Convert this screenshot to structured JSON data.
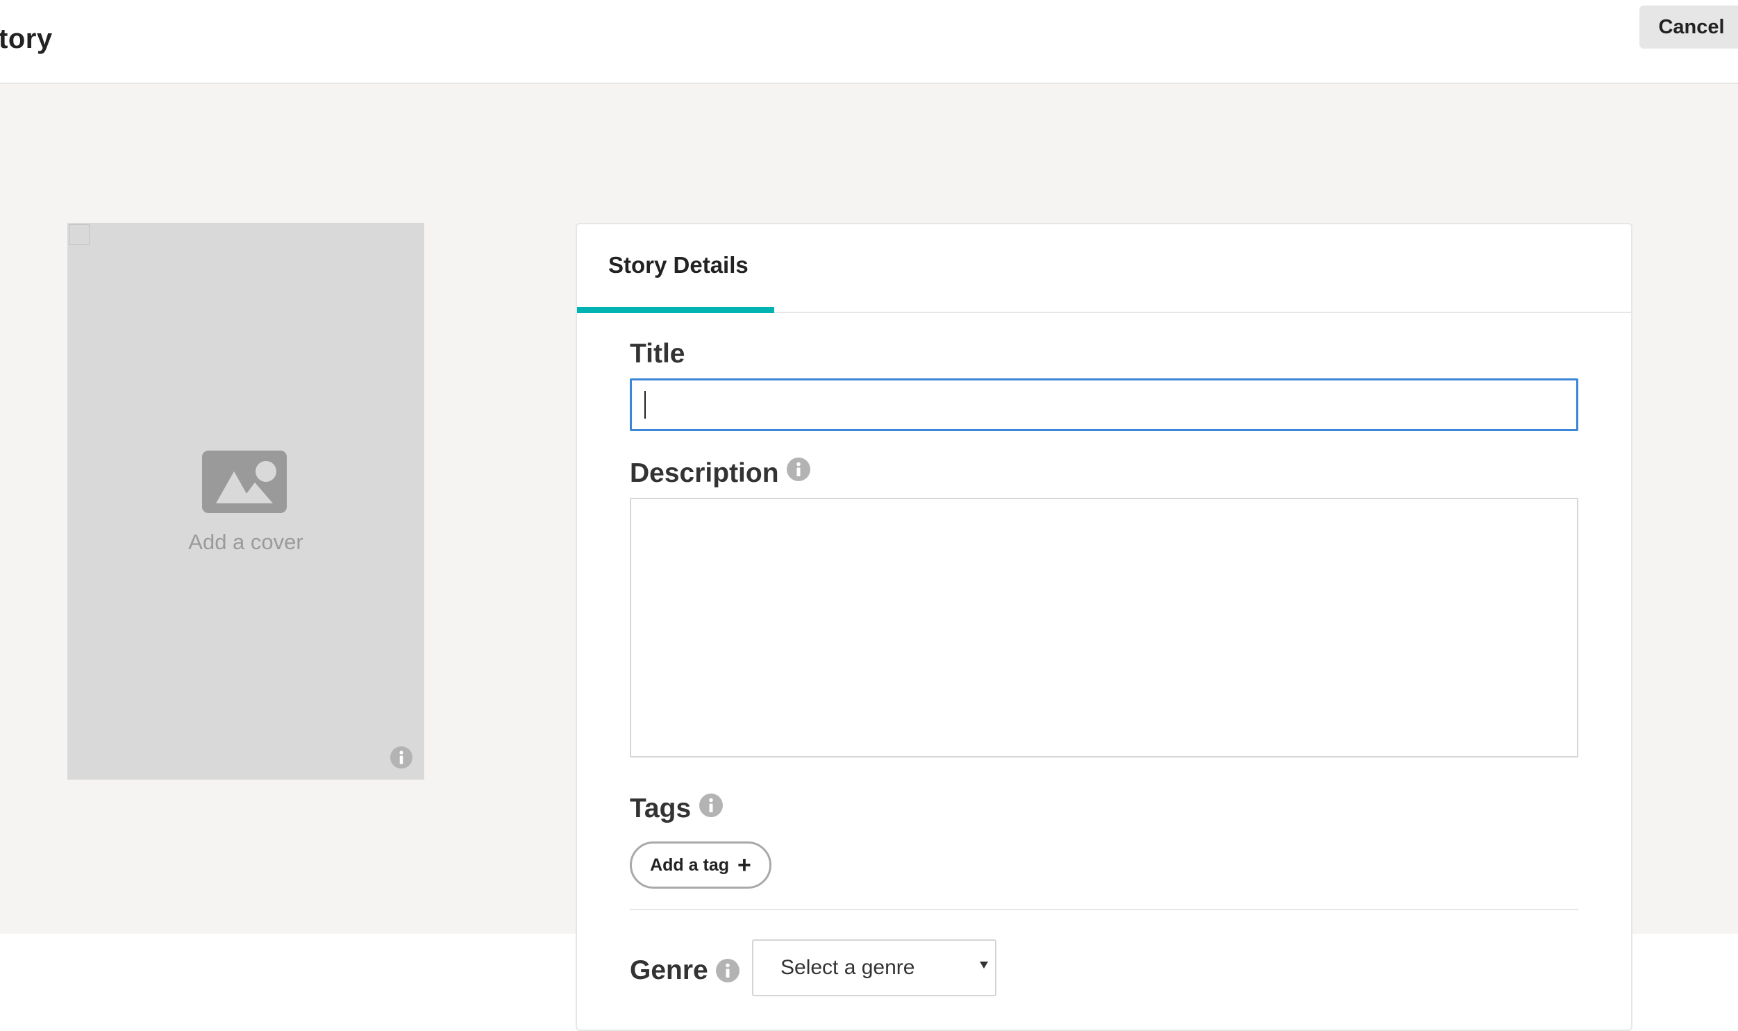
{
  "header": {
    "title": "tory",
    "cancel_label": "Cancel"
  },
  "cover": {
    "label": "Add a cover",
    "image_icon": "image-placeholder-icon",
    "info_icon": "info-icon"
  },
  "tabs": [
    {
      "label": "Story Details",
      "active": true
    }
  ],
  "form": {
    "title": {
      "label": "Title",
      "value": ""
    },
    "description": {
      "label": "Description",
      "value": ""
    },
    "tags": {
      "label": "Tags",
      "add_label": "Add a tag",
      "add_icon": "plus-icon"
    },
    "genre": {
      "label": "Genre",
      "selected": "Select a genre"
    }
  },
  "colors": {
    "accent": "#00b2b2",
    "focus_border": "#3b86d6",
    "main_background": "#f5f4f2",
    "cover_background": "#d9d9d9",
    "cancel_background": "#e6e6e6"
  }
}
